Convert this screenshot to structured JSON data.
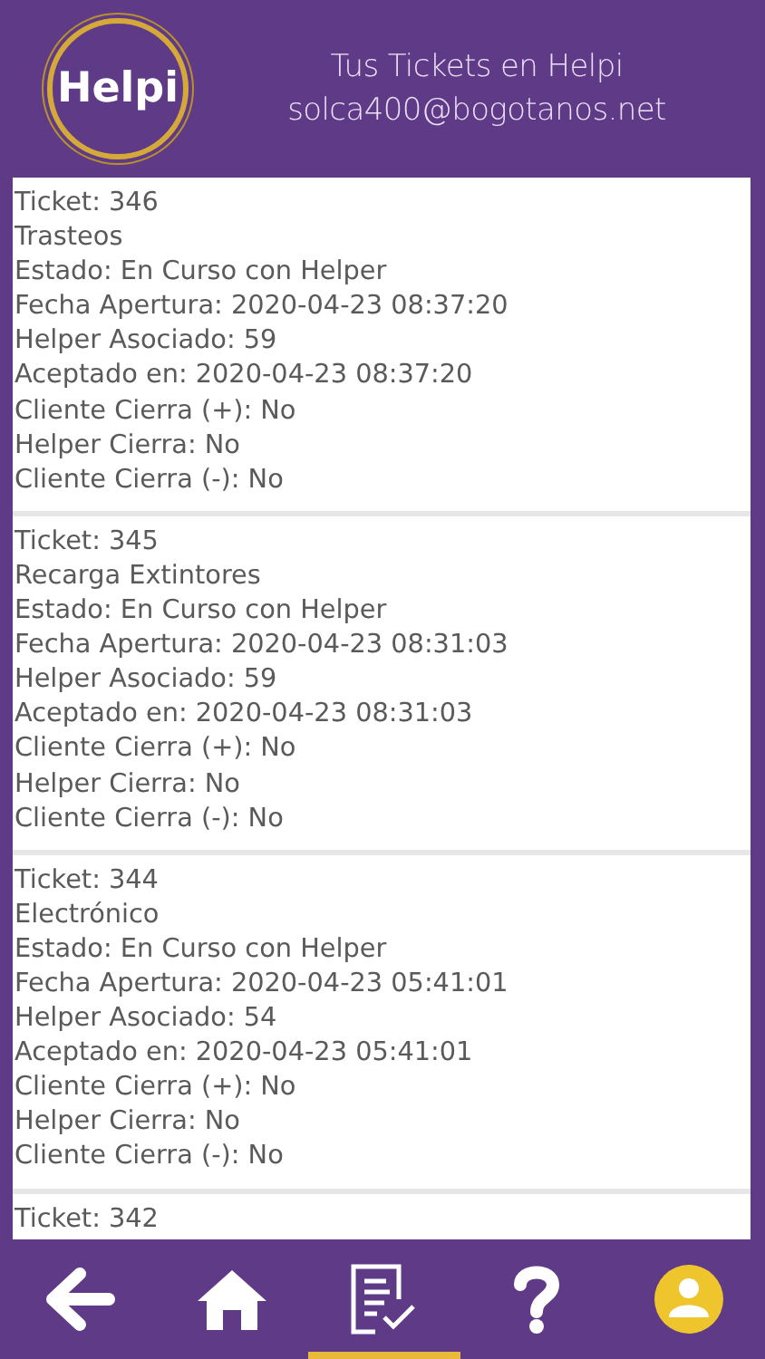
{
  "header": {
    "logo": "Helpi",
    "title": "Tus Tickets en Helpi",
    "email": "solca400@bogotanos.net"
  },
  "tickets": [
    {
      "lines": [
        "Ticket: 346",
        "Trasteos",
        "Estado: En Curso con Helper",
        "Fecha Apertura: 2020-04-23 08:37:20",
        "Helper Asociado: 59",
        "Aceptado en: 2020-04-23 08:37:20",
        "Cliente Cierra (+): No",
        "Helper Cierra: No",
        "Cliente Cierra (-): No"
      ]
    },
    {
      "lines": [
        "Ticket: 345",
        "Recarga Extintores",
        "Estado: En Curso con Helper",
        "Fecha Apertura: 2020-04-23 08:31:03",
        "Helper Asociado: 59",
        "Aceptado en: 2020-04-23 08:31:03",
        "Cliente Cierra (+): No",
        "Helper Cierra: No",
        "Cliente Cierra (-): No"
      ]
    },
    {
      "lines": [
        "Ticket: 344",
        "Electrónico",
        "Estado: En Curso con Helper",
        "Fecha Apertura: 2020-04-23 05:41:01",
        "Helper Asociado: 54",
        "Aceptado en: 2020-04-23 05:41:01",
        "Cliente Cierra (+): No",
        "Helper Cierra: No",
        "Cliente Cierra (-): No"
      ]
    },
    {
      "lines": [
        "Ticket: 342"
      ]
    }
  ],
  "nav": [
    {
      "kind": "back",
      "selected": false
    },
    {
      "kind": "home",
      "selected": false
    },
    {
      "kind": "tickets",
      "selected": true
    },
    {
      "kind": "help",
      "selected": false
    },
    {
      "kind": "profile",
      "selected": false
    }
  ]
}
